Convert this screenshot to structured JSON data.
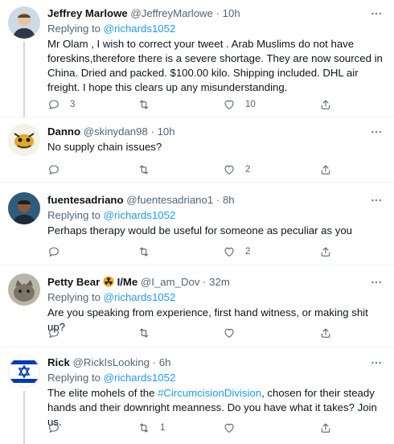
{
  "tweets": [
    {
      "name": "Jeffrey Marlowe",
      "handle": "@JeffreyMarlowe",
      "dot": "·",
      "time": "10h",
      "replying_prefix": "Replying to",
      "replying_to": "@richards1052",
      "body": "Mr Olam , I wish to correct your tweet . Arab Muslims do not have foreskins,therefore there is a severe shortage. They are now sourced in China. Dried and packed. $100.00 kilo. Shipping included. DHL air freight. I hope this clears up any misunderstanding.",
      "replies": "3",
      "retweets": "",
      "likes": "10"
    },
    {
      "name": "Danno",
      "handle": "@skinydan98",
      "dot": "·",
      "time": "10h",
      "body": "No supply chain issues?",
      "replies": "",
      "retweets": "",
      "likes": "2"
    },
    {
      "name": "fuentesadriano",
      "handle": "@fuentesadriano1",
      "dot": "·",
      "time": "8h",
      "replying_prefix": "Replying to",
      "replying_to": "@richards1052",
      "body": "Perhaps therapy would be useful for someone as peculiar as you",
      "replies": "",
      "retweets": "",
      "likes": "2"
    },
    {
      "name": "Petty Bear",
      "name_suffix": "I/Me",
      "handle": "@I_am_Dov",
      "dot": "·",
      "time": "32m",
      "replying_prefix": "Replying to",
      "replying_to": "@richards1052",
      "body": "Are you speaking from experience, first hand witness, or making shit up?",
      "replies": "",
      "retweets": "",
      "likes": ""
    },
    {
      "name": "Rick",
      "handle": "@RickIsLooking",
      "dot": "·",
      "time": "6h",
      "replying_prefix": "Replying to",
      "replying_to": "@richards1052",
      "body_before": "The elite mohels of the ",
      "hashtag": "#CircumcisionDivision",
      "body_after": ", chosen for their steady hands and their downright meanness. Do you have what it takes? Join us.",
      "replies": "",
      "retweets": "1",
      "likes": ""
    }
  ],
  "colors": {
    "link": "#1d9bf0",
    "muted": "#536471",
    "text": "#0f1419",
    "divider": "#eff3f4"
  },
  "icons": [
    "reply-icon",
    "retweet-icon",
    "like-icon",
    "share-icon",
    "more-icon",
    "radioactive-emoji-icon"
  ]
}
